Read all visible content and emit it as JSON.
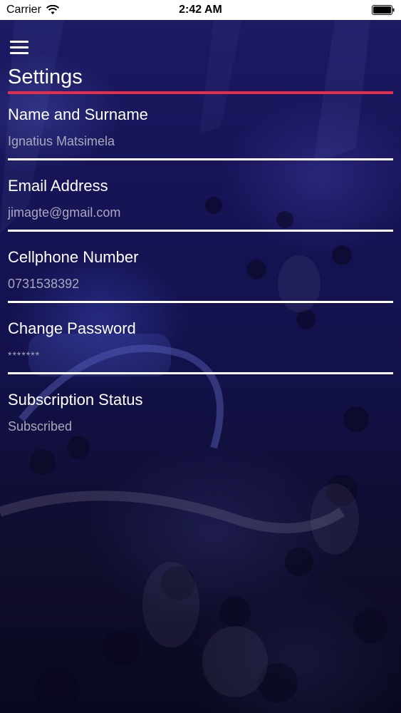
{
  "status_bar": {
    "carrier": "Carrier",
    "time": "2:42 AM",
    "wifi_icon": "wifi-icon",
    "battery_icon": "battery-icon"
  },
  "header": {
    "menu_icon": "hamburger-menu-icon",
    "title": "Settings",
    "accent_color": "#e0304e"
  },
  "fields": [
    {
      "label": "Name and Surname",
      "value": "Ignatius Matsimela"
    },
    {
      "label": "Email Address",
      "value": "jimagte@gmail.com"
    },
    {
      "label": "Cellphone Number",
      "value": "0731538392"
    },
    {
      "label": "Change Password",
      "value": "*******"
    },
    {
      "label": "Subscription Status",
      "value": "Subscribed"
    }
  ]
}
